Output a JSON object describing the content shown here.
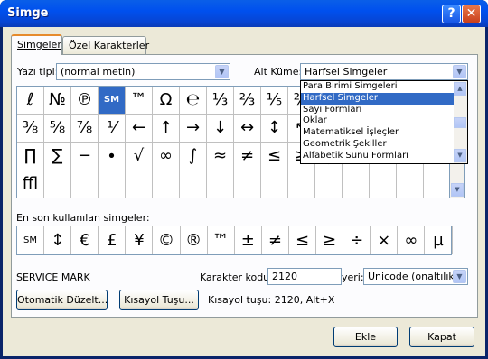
{
  "title": "Simge",
  "title_buttons": {
    "help": "?",
    "close": "✕"
  },
  "tabs": [
    "Simgeler",
    "Özel Karakterler"
  ],
  "font": {
    "label": "Yazı tipi:",
    "value": "(normal metin)"
  },
  "subset": {
    "label": "Alt Küme:",
    "value": "Harfsel Simgeler"
  },
  "subset_options": [
    "Para Birimi Simgeleri",
    "Harfsel Simgeler",
    "Sayı Formları",
    "Oklar",
    "Matematiksel İşleçler",
    "Geometrik Şekiller",
    "Alfabetik Sunu Formları"
  ],
  "subset_selected_index": 1,
  "symbol_rows": [
    [
      "ℓ",
      "№",
      "℗",
      "SM",
      "™",
      "Ω",
      "℮",
      "⅓",
      "⅔",
      "⅕",
      "⅖",
      "⅗",
      "⅘",
      "⅙",
      "⅚",
      "⅛"
    ],
    [
      "⅜",
      "⅝",
      "⅞",
      "⅟",
      "←",
      "↑",
      "→",
      "↓",
      "↔",
      "↕",
      "↖",
      "↗",
      "↘",
      "↙",
      "∂",
      "∆"
    ],
    [
      "∏",
      "∑",
      "−",
      "∙",
      "√",
      "∞",
      "∫",
      "≈",
      "≠",
      "≤",
      "≥",
      "◊",
      "",
      "",
      "",
      ""
    ],
    [
      "ﬄ",
      "",
      "",
      "",
      "",
      "",
      "",
      "",
      "",
      "",
      "",
      "",
      "",
      "",
      "",
      ""
    ]
  ],
  "selected_symbol": "SM",
  "recent": {
    "label": "En son kullanılan simgeler:",
    "items": [
      "SM",
      "↕",
      "€",
      "£",
      "¥",
      "©",
      "®",
      "™",
      "±",
      "≠",
      "≤",
      "≥",
      "÷",
      "×",
      "∞",
      "µ"
    ]
  },
  "char_name": "SERVICE MARK",
  "char_code": {
    "label": "Karakter kodu:",
    "value": "2120"
  },
  "from": {
    "label": "yeri:",
    "value": "Unicode (onaltılık)"
  },
  "autocorrect_button": "Otomatik Düzelt...",
  "shortcut_button": "Kısayol Tuşu...",
  "shortcut_info": "Kısayol tuşu: 2120, Alt+X",
  "insert_button": "Ekle",
  "cancel_button": "Kapat",
  "icons": {
    "dropdown": "chevron-down-icon",
    "scroll_up": "arrow-up-icon",
    "scroll_down": "arrow-down-icon"
  }
}
